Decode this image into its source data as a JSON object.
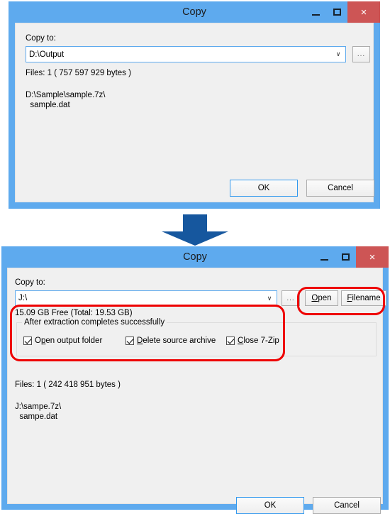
{
  "dialog_top": {
    "title": "Copy",
    "window_buttons": {
      "minimize": "minimize-icon",
      "maximize": "maximize-icon",
      "close": "×"
    },
    "copy_to_label": "Copy to:",
    "path_value": "D:\\Output",
    "path_placeholder": "",
    "dropdown_arrow": "∨",
    "browse_label": "...",
    "files_line": "Files: 1    ( 757 597 929 bytes )",
    "listing": "D:\\Sample\\sample.7z\\\n  sample.dat",
    "ok_label": "OK",
    "cancel_label": "Cancel"
  },
  "dialog_bottom": {
    "title": "Copy",
    "window_buttons": {
      "minimize": "minimize-icon",
      "maximize": "maximize-icon",
      "close": "×"
    },
    "copy_to_label": "Copy to:",
    "path_value": "J:\\",
    "dropdown_arrow": "∨",
    "browse_label": "...",
    "open_label_pre": "",
    "open_label_acc": "O",
    "open_label_post": "pen",
    "filename_label_acc": "F",
    "filename_label_post": "ilename",
    "free_space_line": "15.09 GB Free (Total: 19.53 GB)",
    "group_title": "After extraction completes successfully",
    "checkboxes": [
      {
        "pre": "O",
        "acc": "p",
        "post": "en output folder",
        "checked": true
      },
      {
        "pre": "",
        "acc": "D",
        "post": "elete source archive",
        "checked": true
      },
      {
        "pre": "",
        "acc": "C",
        "post": "lose 7-Zip",
        "checked": true
      }
    ],
    "files_line": "Files: 1   ( 242 418 951 bytes )",
    "listing": "J:\\sampe.7z\\\n  sampe.dat",
    "ok_label": "OK",
    "cancel_label": "Cancel"
  },
  "annotations": {
    "arrow_direction": "down",
    "arrow_color": "#16579e",
    "highlight_color": "#ee0000",
    "highlights": [
      "open-filename-buttons",
      "after-extraction-options"
    ]
  },
  "colors": {
    "titlebar": "#5eaaee",
    "close_button": "#cd5555",
    "client": "#f0f0f0",
    "accent": "#3399ee"
  }
}
